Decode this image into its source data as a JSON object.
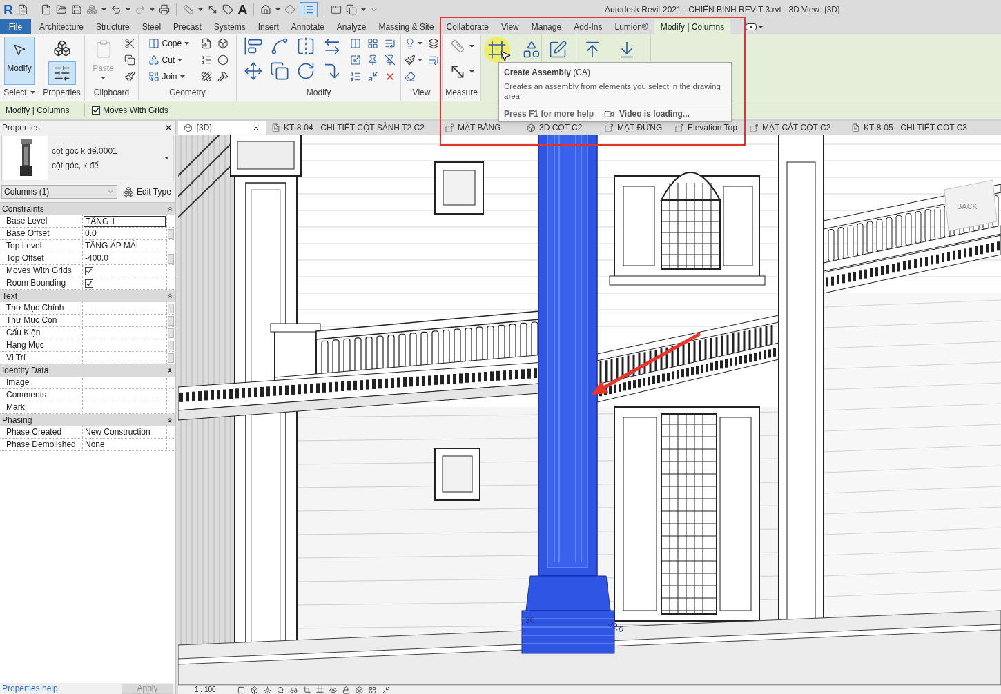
{
  "window": {
    "title": "Autodesk Revit 2021 - CHIẾN BINH REVIT 3.rvt - 3D View: {3D}"
  },
  "quick_access": {
    "logo": "R",
    "text_tool": "A",
    "thin_lines": true
  },
  "ribbon_tabs": [
    {
      "label": "File",
      "kind": "file",
      "selected": false
    },
    {
      "label": "Architecture",
      "kind": "tab",
      "selected": false
    },
    {
      "label": "Structure",
      "kind": "tab",
      "selected": false
    },
    {
      "label": "Steel",
      "kind": "tab",
      "selected": false
    },
    {
      "label": "Precast",
      "kind": "tab",
      "selected": false
    },
    {
      "label": "Systems",
      "kind": "tab",
      "selected": false
    },
    {
      "label": "Insert",
      "kind": "tab",
      "selected": false
    },
    {
      "label": "Annotate",
      "kind": "tab",
      "selected": false
    },
    {
      "label": "Analyze",
      "kind": "tab",
      "selected": false
    },
    {
      "label": "Massing & Site",
      "kind": "tab",
      "selected": false
    },
    {
      "label": "Collaborate",
      "kind": "tab",
      "selected": false
    },
    {
      "label": "View",
      "kind": "tab",
      "selected": false
    },
    {
      "label": "Manage",
      "kind": "tab",
      "selected": false
    },
    {
      "label": "Add-Ins",
      "kind": "tab",
      "selected": false
    },
    {
      "label": "Lumion®",
      "kind": "tab",
      "selected": false
    },
    {
      "label": "Modify | Columns",
      "kind": "tab",
      "selected": true
    }
  ],
  "ribbon_panels": [
    {
      "kind": "select",
      "title": "Select",
      "menu": true,
      "tools": [
        {
          "label": "Modify",
          "selected": true
        }
      ]
    },
    {
      "kind": "properties",
      "title": "Properties",
      "tools": [
        {
          "selected": false
        },
        {
          "selected": true
        }
      ]
    },
    {
      "kind": "clipboard",
      "title": "Clipboard",
      "tools": [
        {
          "label": "Paste",
          "disabled": true
        }
      ]
    },
    {
      "kind": "geometry",
      "title": "Geometry",
      "tools": [
        {
          "label": "Cope"
        },
        {
          "label": "Cut"
        },
        {
          "label": "Join"
        }
      ]
    },
    {
      "kind": "modify",
      "title": "Modify"
    },
    {
      "kind": "view",
      "title": "View"
    },
    {
      "kind": "measure",
      "title": "Measure"
    }
  ],
  "contextual_panels": [
    {
      "kind": "create",
      "tools": [
        {
          "hovered": true
        },
        {
          "hovered": false
        }
      ]
    },
    {
      "kind": "mode",
      "tools": [
        {
          "hovered": false
        }
      ]
    },
    {
      "kind": "modify-column",
      "tools": [
        {
          "hovered": false
        },
        {
          "hovered": false
        }
      ]
    }
  ],
  "tooltip": {
    "title": "**Create Assembly** (CA)",
    "description": "Creates an assembly from elements you select in the drawing area.",
    "help": "Press F1 for more help",
    "video": "Video is loading..."
  },
  "options_bar": {
    "context": "Modify | Columns",
    "checkbox": {
      "label": "Moves With Grids",
      "checked": true
    }
  },
  "properties": {
    "title": "Properties",
    "type_name": "cột góc k đế.0001",
    "type_family": "cột góc, k đế",
    "filter": "Columns (1)",
    "edit_type": "Edit Type",
    "groups": [
      {
        "title": "Constraints",
        "expanded": true,
        "rows": [
          {
            "label": "Base Level",
            "value": "TẦNG 1",
            "kind": "field",
            "param_button": false
          },
          {
            "label": "Base Offset",
            "value": "0.0",
            "kind": "text",
            "param_button": true
          },
          {
            "label": "Top Level",
            "value": "TẦNG ÁP MÁI",
            "kind": "text",
            "param_button": false
          },
          {
            "label": "Top Offset",
            "value": "-400.0",
            "kind": "text",
            "param_button": true
          },
          {
            "label": "Moves With Grids",
            "kind": "checkbox",
            "checked": true,
            "param_button": false
          },
          {
            "label": "Room Bounding",
            "kind": "checkbox",
            "checked": true,
            "param_button": false
          }
        ]
      },
      {
        "title": "Text",
        "expanded": true,
        "rows": [
          {
            "label": "Thư Mục Chính",
            "kind": "text",
            "param_button": true
          },
          {
            "label": "Thư Mục Con",
            "kind": "text",
            "param_button": true
          },
          {
            "label": "Cấu Kiện",
            "kind": "text",
            "param_button": true
          },
          {
            "label": "Hạng Mục",
            "kind": "text",
            "param_button": true
          },
          {
            "label": "Vị Trí",
            "kind": "text",
            "param_button": true
          }
        ]
      },
      {
        "title": "Identity Data",
        "expanded": true,
        "rows": [
          {
            "label": "Image",
            "kind": "text",
            "param_button": false
          },
          {
            "label": "Comments",
            "kind": "text",
            "param_button": false
          },
          {
            "label": "Mark",
            "kind": "text",
            "param_button": false
          }
        ]
      },
      {
        "title": "Phasing",
        "expanded": true,
        "rows": [
          {
            "label": "Phase Created",
            "value": "New Construction",
            "kind": "text",
            "param_button": false
          },
          {
            "label": "Phase Demolished",
            "value": "None",
            "kind": "text",
            "param_button": false
          }
        ]
      }
    ],
    "help_link": "Properties help",
    "apply": {
      "label": "Apply",
      "disabled": true
    }
  },
  "view_tabs": [
    {
      "label": "{3D}",
      "kind": "model",
      "selected": true
    },
    {
      "label": "KT-8-04 - CHI TIẾT CỘT SẢNH T2 C2",
      "kind": "sheet",
      "selected": false
    },
    {
      "label": "MẶT BẰNG",
      "kind": "plan",
      "selected": false
    },
    {
      "label": "3D CỘT C2",
      "kind": "model",
      "selected": false
    },
    {
      "label": "MẶT ĐỨNG",
      "kind": "elevation",
      "selected": false
    },
    {
      "label": "Elevation Top",
      "kind": "elevation",
      "selected": false
    },
    {
      "label": "MẶT CẮT CỘT C2",
      "kind": "section",
      "selected": false
    },
    {
      "label": "KT-8-05 - CHI TIẾT CỘT C3",
      "kind": "sheet",
      "selected": false
    }
  ],
  "viewport": {
    "dimension_labels": [
      "30",
      "30.0"
    ],
    "view_cube": "BACK"
  },
  "view_control_bar": {
    "scale": "1 : 100"
  }
}
